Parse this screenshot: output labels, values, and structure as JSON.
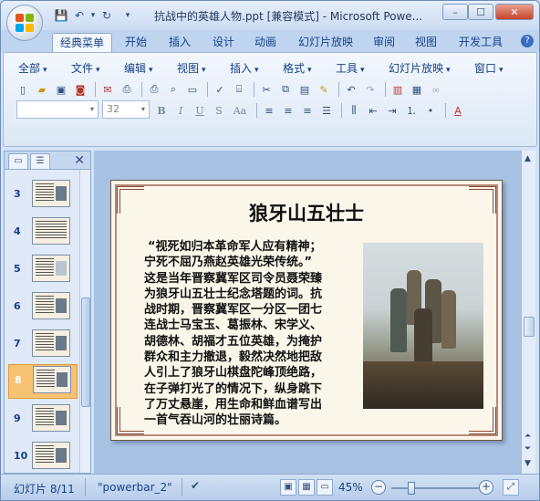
{
  "window": {
    "title": "抗战中的英雄人物.ppt [兼容模式] - Microsoft Powe...",
    "controls": [
      "–",
      "☐",
      "✕"
    ]
  },
  "quick_access": {
    "save": "💾",
    "undo": "↶",
    "redo": "↻",
    "more": "▾"
  },
  "tabs": [
    "经典菜单",
    "开始",
    "插入",
    "设计",
    "动画",
    "幻灯片放映",
    "审阅",
    "视图",
    "开发工具"
  ],
  "help": "?",
  "menus": [
    "全部",
    "文件",
    "编辑",
    "视图",
    "插入",
    "格式",
    "工具",
    "幻灯片放映",
    "窗口"
  ],
  "font": {
    "name": "",
    "size": "32"
  },
  "format_buttons": [
    "B",
    "I",
    "U",
    "S",
    "Aa"
  ],
  "panel": {
    "tab_outline": "▭",
    "tab_slides": "☰",
    "close": "✕",
    "slides": [
      {
        "num": "3"
      },
      {
        "num": "4"
      },
      {
        "num": "5"
      },
      {
        "num": "6"
      },
      {
        "num": "7"
      },
      {
        "num": "8",
        "selected": true
      },
      {
        "num": "9"
      },
      {
        "num": "10"
      }
    ]
  },
  "slide": {
    "title": "狼牙山五壮士",
    "body": [
      "“视死如归本革命军人应有精神；",
      "宁死不屈乃燕赵英雄光荣传统。”",
      "这是当年晋察冀军区司令员聂荣臻",
      "为狼牙山五壮士纪念塔题的词。抗",
      "战时期，晋察冀军区一分区一团七",
      "连战士马宝玉、葛振林、宋学义、",
      "胡德林、胡福才五位英雄，为掩护",
      "群众和主力撤退，毅然决然地把敌",
      "人引上了狼牙山棋盘陀峰顶绝路，",
      "在子弹打光了的情况下，纵身跳下",
      "了万丈悬崖，用生命和鲜血谱写出",
      "一首气吞山河的壮丽诗篇。"
    ]
  },
  "status": {
    "slide_info": "幻灯片 8/11",
    "theme": "\"powerbar_2\"",
    "zoom": "45%",
    "zoom_fraction": 0.2
  },
  "colors": {
    "accent": "#15428b",
    "selected": "#f7c272"
  }
}
